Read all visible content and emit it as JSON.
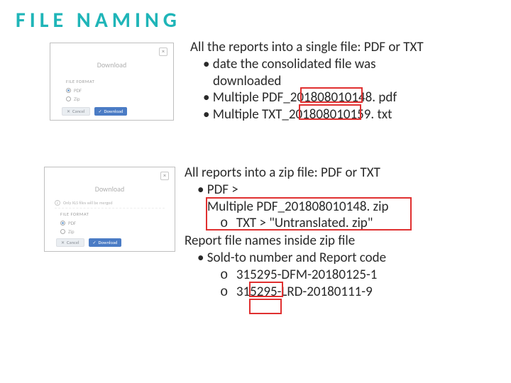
{
  "title": "FILE NAMING",
  "dialog1": {
    "title": "Download",
    "section_label": "FILE FORMAT",
    "opt1": "PDF",
    "opt2": "Zip",
    "cancel": "Cancel",
    "download": "Download"
  },
  "dialog2": {
    "title": "Download",
    "note": "Only XLS files will be merged",
    "section_label": "FILE FORMAT",
    "opt1": "PDF",
    "opt2": "Zip",
    "cancel": "Cancel",
    "download": "Download"
  },
  "section1": {
    "heading": "All the reports into a single file: PDF or TXT",
    "b1": "date the consolidated file was",
    "b1b": "downloaded",
    "b2_pre": "Multiple PDF_",
    "b2_hl": "201808010",
    "b2_post": "148. pdf",
    "b3_pre": "Multiple TXT_",
    "b3_hl": "201808010",
    "b3_post": "159. txt"
  },
  "section2": {
    "heading": "All reports into a zip file: PDF or TXT",
    "b1": "PDF >",
    "b1_hl": "Multiple PDF_201808010148. zip",
    "b2_pre": "TXT  > \"Untranslated. zip\"",
    "sub_heading": "Report file names inside zip file",
    "b3": "Sold-to number and Report code",
    "b3a_pre": "315295-",
    "b3a_mid": "DFM-",
    "b3a_post": "20180125-1",
    "b3b_pre": "315295-",
    "b3b_mid": "LRD-",
    "b3b_post": "20180111-9"
  }
}
